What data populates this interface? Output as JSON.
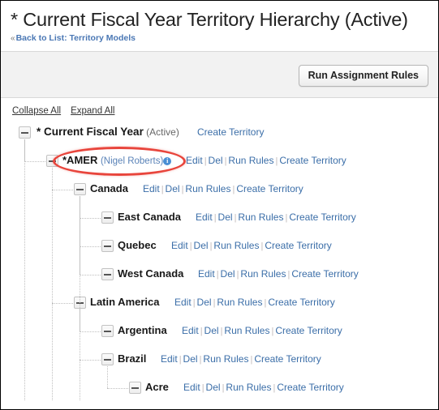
{
  "header": {
    "title": "* Current Fiscal Year Territory Hierarchy (Active)",
    "back_chevron": "«",
    "back_link": "Back to List: Territory Models"
  },
  "toolbar": {
    "run_assignment_rules": "Run Assignment Rules"
  },
  "tree_controls": {
    "collapse_all": "Collapse All",
    "expand_all": "Expand All"
  },
  "actions": {
    "edit": "Edit",
    "del": "Del",
    "run_rules": "Run Rules",
    "create_territory": "Create Territory",
    "separator": "|"
  },
  "icons": {
    "toggle": "minus-box-icon",
    "info": "i"
  },
  "colors": {
    "link": "#3b6ea8",
    "title": "#222222",
    "toolbar_bg": "#f2f2f2",
    "annotation": "#e8453c",
    "info_badge": "#4a8fd4"
  },
  "tree": {
    "rows": [
      {
        "id": "current-fiscal-year",
        "label": "* Current Fiscal Year",
        "suffix": " (Active)",
        "owner": "",
        "level": 0,
        "has_info_icon": false,
        "actions": [
          "create_territory"
        ]
      },
      {
        "id": "amer",
        "label": "*AMER",
        "suffix": "",
        "owner": "(Nigel Roberts)",
        "level": 1,
        "has_info_icon": true,
        "highlighted": true,
        "actions": [
          "edit",
          "del",
          "run_rules",
          "create_territory"
        ]
      },
      {
        "id": "canada",
        "label": "Canada",
        "suffix": "",
        "owner": "",
        "level": 2,
        "has_info_icon": false,
        "actions": [
          "edit",
          "del",
          "run_rules",
          "create_territory"
        ]
      },
      {
        "id": "east-canada",
        "label": "East Canada",
        "suffix": "",
        "owner": "",
        "level": 3,
        "has_info_icon": false,
        "actions": [
          "edit",
          "del",
          "run_rules",
          "create_territory"
        ]
      },
      {
        "id": "quebec",
        "label": "Quebec",
        "suffix": "",
        "owner": "",
        "level": 3,
        "has_info_icon": false,
        "actions": [
          "edit",
          "del",
          "run_rules",
          "create_territory"
        ]
      },
      {
        "id": "west-canada",
        "label": "West Canada",
        "suffix": "",
        "owner": "",
        "level": 3,
        "has_info_icon": false,
        "actions": [
          "edit",
          "del",
          "run_rules",
          "create_territory"
        ]
      },
      {
        "id": "latin-america",
        "label": "Latin America",
        "suffix": "",
        "owner": "",
        "level": 2,
        "has_info_icon": false,
        "actions": [
          "edit",
          "del",
          "run_rules",
          "create_territory"
        ]
      },
      {
        "id": "argentina",
        "label": "Argentina",
        "suffix": "",
        "owner": "",
        "level": 3,
        "has_info_icon": false,
        "actions": [
          "edit",
          "del",
          "run_rules",
          "create_territory"
        ]
      },
      {
        "id": "brazil",
        "label": "Brazil",
        "suffix": "",
        "owner": "",
        "level": 3,
        "has_info_icon": false,
        "actions": [
          "edit",
          "del",
          "run_rules",
          "create_territory"
        ]
      },
      {
        "id": "acre",
        "label": "Acre",
        "suffix": "",
        "owner": "",
        "level": 4,
        "has_info_icon": false,
        "actions": [
          "edit",
          "del",
          "run_rules",
          "create_territory"
        ]
      }
    ]
  }
}
